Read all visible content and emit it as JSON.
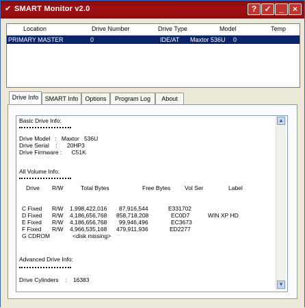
{
  "titlebar": {
    "title": "SMART Monitor v2.0",
    "buttons": [
      "?",
      "✓",
      "_",
      "×"
    ]
  },
  "drives_list": {
    "columns": [
      "Location",
      "Drive Number",
      "Drive Type",
      "Model",
      "Temp"
    ],
    "rows": [
      {
        "location": "PRIMARY MASTER",
        "drive_number": "0",
        "drive_type": "IDE/AT",
        "model": "Maxtor  536U",
        "temp": "0"
      }
    ]
  },
  "tabs": [
    "Drive Info",
    "SMART Info",
    "Options",
    "Program Log",
    "About"
  ],
  "drive_info": {
    "basic_header": "Basic Drive Info:",
    "model_line": "Drive Model   :   Maxtor   536U",
    "serial_line": "Drive Serial    :      20HP3",
    "firmware_line": "Drive Firmware :      C51K",
    "all_volume_header": "All Volume Info:",
    "volume_columns": [
      "Drive",
      "R/W",
      "Total Bytes",
      "Free Bytes",
      "Vol Ser",
      "Label"
    ],
    "volumes": [
      [
        "C Fixed",
        "R/W",
        "1,998,422,016",
        "87,916,544",
        "E331702",
        ""
      ],
      [
        "D Fixed",
        "R/W",
        "4,186,656,768",
        "858,718,208",
        "EC0D7",
        "WIN XP HD"
      ],
      [
        "E Fixed",
        "R/W",
        "4,186,656,768",
        "99,946,496",
        "EC3673",
        ""
      ],
      [
        "F Fixed",
        "R/W",
        "4,966,535,168",
        "479,911,936",
        "ED2277",
        ""
      ],
      [
        "G CDROM",
        "",
        "<disk missing>",
        "",
        "",
        ""
      ]
    ],
    "advanced_header": "Advanced Drive Info:",
    "cylinders_line": "Drive Cylinders    :    16383"
  },
  "colors": {
    "title_bar": "#9a0f12",
    "selected_row": "#0a246a"
  }
}
